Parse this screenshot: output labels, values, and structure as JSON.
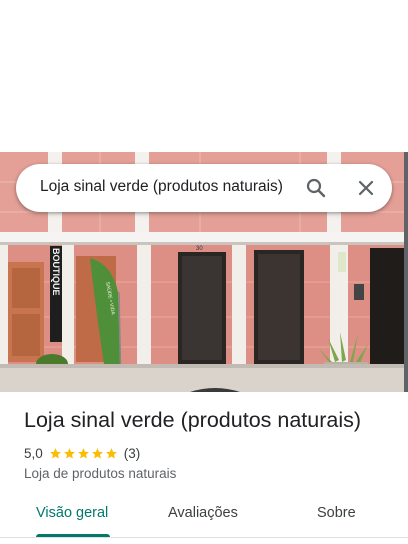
{
  "search": {
    "query": "Loja sinal verde (produtos naturais)",
    "search_icon": "search-icon",
    "close_icon": "close-icon"
  },
  "photo": {
    "sign_text": "BOUTIQUE",
    "flag_text": "SAÚDE • VIDA",
    "door_number": "30"
  },
  "place": {
    "title": "Loja sinal verde (produtos naturais)",
    "rating": "5,0",
    "stars": 5,
    "review_count": "(3)",
    "category": "Loja de produtos naturais"
  },
  "tabs": [
    {
      "label": "Visão geral",
      "active": true
    },
    {
      "label": "Avaliações",
      "active": false
    },
    {
      "label": "Sobre",
      "active": false
    }
  ],
  "colors": {
    "accent": "#00796b",
    "star": "#fbbc04",
    "wall": "#e8a39a"
  }
}
